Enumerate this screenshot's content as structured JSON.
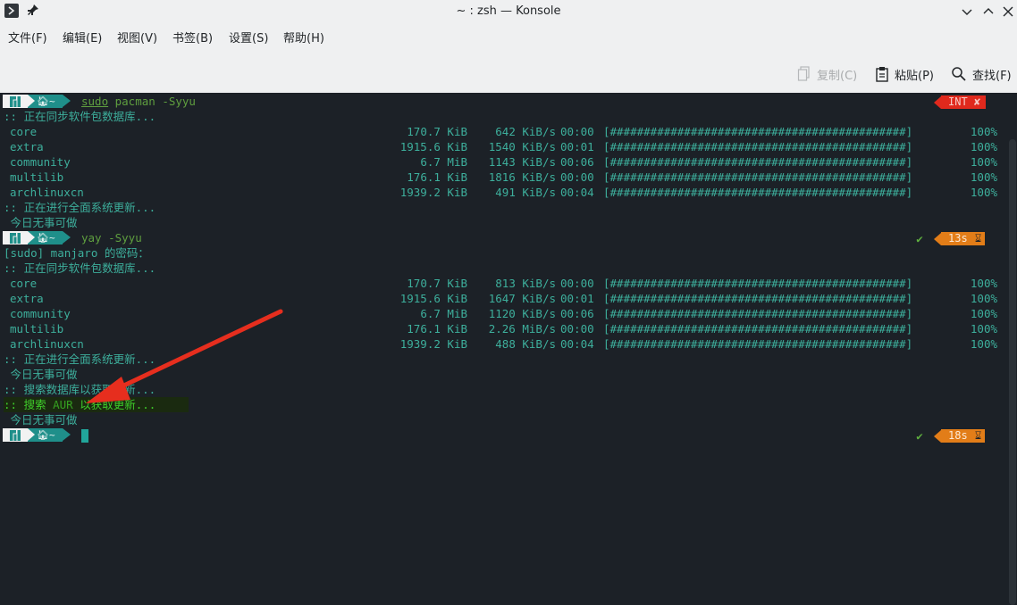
{
  "window": {
    "title": "~ : zsh — Konsole",
    "app_icon": "terminal-icon",
    "pin_icon": "pin-icon",
    "buttons": [
      "minimize-icon",
      "maximize-icon",
      "close-icon"
    ]
  },
  "menubar": {
    "items": [
      "文件(F)",
      "编辑(E)",
      "视图(V)",
      "书签(B)",
      "设置(S)",
      "帮助(H)"
    ]
  },
  "toolbar": {
    "copy": "复制(C)",
    "paste": "粘贴(P)",
    "find": "查找(F)"
  },
  "terminal": {
    "prompt_dir": "~",
    "cmd1_sudo": "sudo",
    "cmd1_rest": " pacman -Syyu",
    "indicator_int": "INT ✘",
    "sync1": ":: 正在同步软件包数据库...",
    "repos1": [
      {
        "name": "core",
        "size": "170.7 KiB",
        "speed": "642 KiB/s",
        "time": "00:00",
        "bar": "[############################################]",
        "pct": "100%"
      },
      {
        "name": "extra",
        "size": "1915.6 KiB",
        "speed": "1540 KiB/s",
        "time": "00:01",
        "bar": "[############################################]",
        "pct": "100%"
      },
      {
        "name": "community",
        "size": "6.7 MiB",
        "speed": "1143 KiB/s",
        "time": "00:06",
        "bar": "[############################################]",
        "pct": "100%"
      },
      {
        "name": "multilib",
        "size": "176.1 KiB",
        "speed": "1816 KiB/s",
        "time": "00:00",
        "bar": "[############################################]",
        "pct": "100%"
      },
      {
        "name": "archlinuxcn",
        "size": "1939.2 KiB",
        "speed": "491 KiB/s",
        "time": "00:04",
        "bar": "[############################################]",
        "pct": "100%"
      }
    ],
    "upgrade1": ":: 正在进行全面系统更新...",
    "nothing1": " 今日无事可做",
    "cmd2": "yay -Syyu",
    "check": "✔",
    "time2": "13s",
    "sudo_prompt": "[sudo] manjaro 的密码：",
    "sync2": ":: 正在同步软件包数据库...",
    "repos2": [
      {
        "name": "core",
        "size": "170.7 KiB",
        "speed": "813 KiB/s",
        "time": "00:00",
        "bar": "[############################################]",
        "pct": "100%"
      },
      {
        "name": "extra",
        "size": "1915.6 KiB",
        "speed": "1647 KiB/s",
        "time": "00:01",
        "bar": "[############################################]",
        "pct": "100%"
      },
      {
        "name": "community",
        "size": "6.7 MiB",
        "speed": "1120 KiB/s",
        "time": "00:06",
        "bar": "[############################################]",
        "pct": "100%"
      },
      {
        "name": "multilib",
        "size": "176.1 KiB",
        "speed": "2.26 MiB/s",
        "time": "00:00",
        "bar": "[############################################]",
        "pct": "100%"
      },
      {
        "name": "archlinuxcn",
        "size": "1939.2 KiB",
        "speed": "488 KiB/s",
        "time": "00:04",
        "bar": "[############################################]",
        "pct": "100%"
      }
    ],
    "upgrade2": ":: 正在进行全面系统更新...",
    "nothing2": " 今日无事可做",
    "searchdb": ":: 搜索数据库以获取更新...",
    "searchaur_prefix": ":: 搜索 ",
    "searchaur_aur": "AUR",
    "searchaur_rest": " 以获取更新...",
    "nothing3": " 今日无事可做",
    "time3": "18s",
    "hourglass_icon": "hourglass-icon"
  },
  "colors": {
    "terminal_bg": "#1c2127",
    "text": "#3daf9c",
    "int_indicator": "#e0291d",
    "time_indicator": "#e27d18",
    "arrow": "#e62e1e"
  }
}
